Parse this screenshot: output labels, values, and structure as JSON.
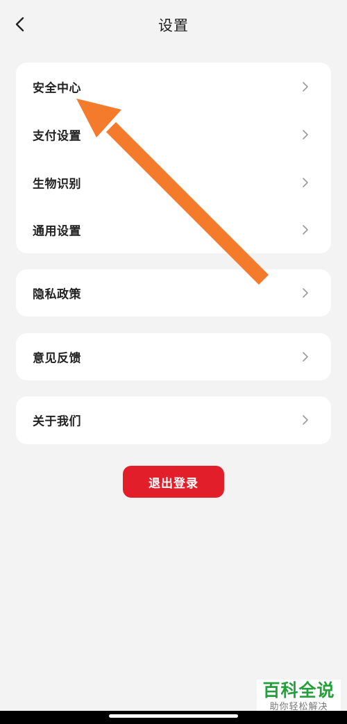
{
  "header": {
    "title": "设置",
    "back_icon": "chevron-left-icon"
  },
  "settings": {
    "group1": [
      {
        "label": "安全中心"
      },
      {
        "label": "支付设置"
      },
      {
        "label": "生物识别"
      },
      {
        "label": "通用设置"
      }
    ],
    "privacy": {
      "label": "隐私政策"
    },
    "feedback": {
      "label": "意见反馈"
    },
    "about": {
      "label": "关于我们"
    },
    "chevron_icon": "chevron-right-icon"
  },
  "logout": {
    "label": "退出登录"
  },
  "colors": {
    "background": "#f3f3f3",
    "card": "#ffffff",
    "logout_button": "#e21e2b",
    "annotation_arrow": "#f47a2c",
    "watermark_text": "#23a03a"
  },
  "watermark": {
    "main": "百科全说",
    "sub": "助你轻松解决"
  }
}
